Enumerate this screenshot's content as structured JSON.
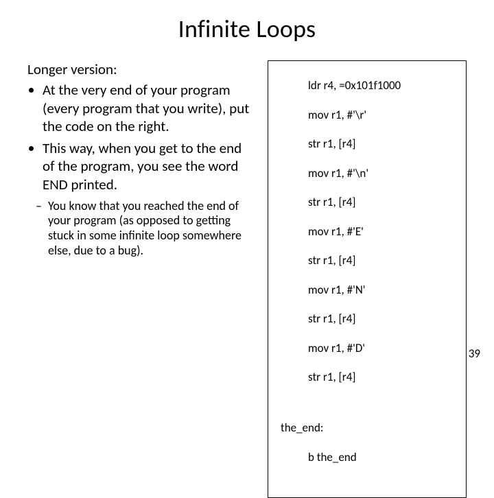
{
  "title": "Infinite Loops",
  "left": {
    "intro": "Longer version:",
    "bullet1": "At the very end of your program (every program that you write), put the code on the right.",
    "bullet2": "This way, when you get to the end of the program, you see the word END printed.",
    "sub": "You know that you reached the end of your program  (as opposed to getting stuck in some infinite loop somewhere else, due to a bug)."
  },
  "code": {
    "l01": "ldr r4, =0x101f1000",
    "l02": "mov r1, #'\\r'",
    "l03": "str r1, [r4]",
    "l04": "mov r1, #'\\n'",
    "l05": "str r1, [r4]",
    "l06": "mov r1, #'E'",
    "l07": "str r1, [r4]",
    "l08": "mov r1, #'N'",
    "l09": "str r1, [r4]",
    "l10": "mov r1, #'D'",
    "l11": "str r1, [r4]",
    "label": "the_end:",
    "bline": "b the_end"
  },
  "page": "39"
}
